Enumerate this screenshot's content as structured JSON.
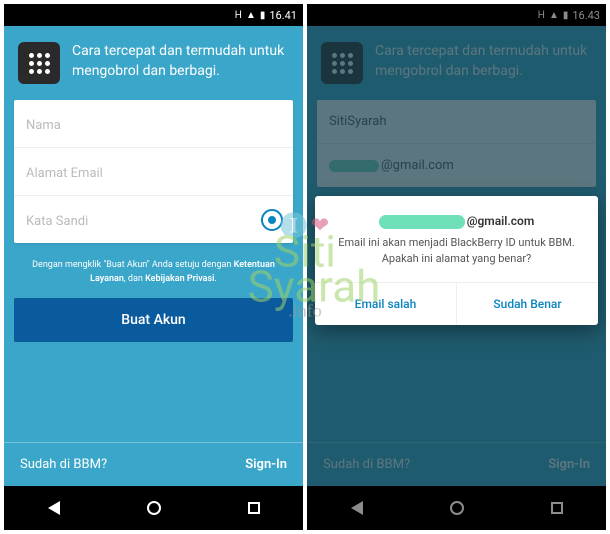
{
  "left": {
    "status": {
      "network": "H",
      "signal": "▲",
      "battery": "▮",
      "time": "16.41"
    },
    "tagline": "Cara tercepat dan termudah untuk mengobrol dan berbagi.",
    "form": {
      "name_placeholder": "Nama",
      "email_placeholder": "Alamat Email",
      "password_placeholder": "Kata Sandi"
    },
    "terms_prefix": "Dengan mengklik \"Buat Akun\" Anda setuju dengan ",
    "terms_tos": "Ketentuan Layanan",
    "terms_and": ", dan ",
    "terms_privacy": "Kebijakan Privasi",
    "terms_end": ".",
    "create_button": "Buat Akun",
    "footer_already": "Sudah di BBM?",
    "footer_signin": "Sign-In"
  },
  "right": {
    "status": {
      "network": "H",
      "signal": "▲",
      "battery": "▮",
      "time": "16.43"
    },
    "tagline": "Cara tercepat dan termudah untuk mengobrol dan berbagi.",
    "form": {
      "name_value": "SitiSyarah",
      "email_suffix": "@gmail.com"
    },
    "dialog": {
      "email_suffix": "@gmail.com",
      "message": "Email ini akan menjadi BlackBerry ID untuk BBM. Apakah ini alamat yang benar?",
      "wrong": "Email salah",
      "correct": "Sudah Benar"
    },
    "footer_already": "Sudah di BBM?",
    "footer_signin": "Sign-In"
  },
  "watermark": {
    "i": "I",
    "heart": "❤",
    "name1": "Siti",
    "name2": "Syarah",
    "info": ".info"
  }
}
